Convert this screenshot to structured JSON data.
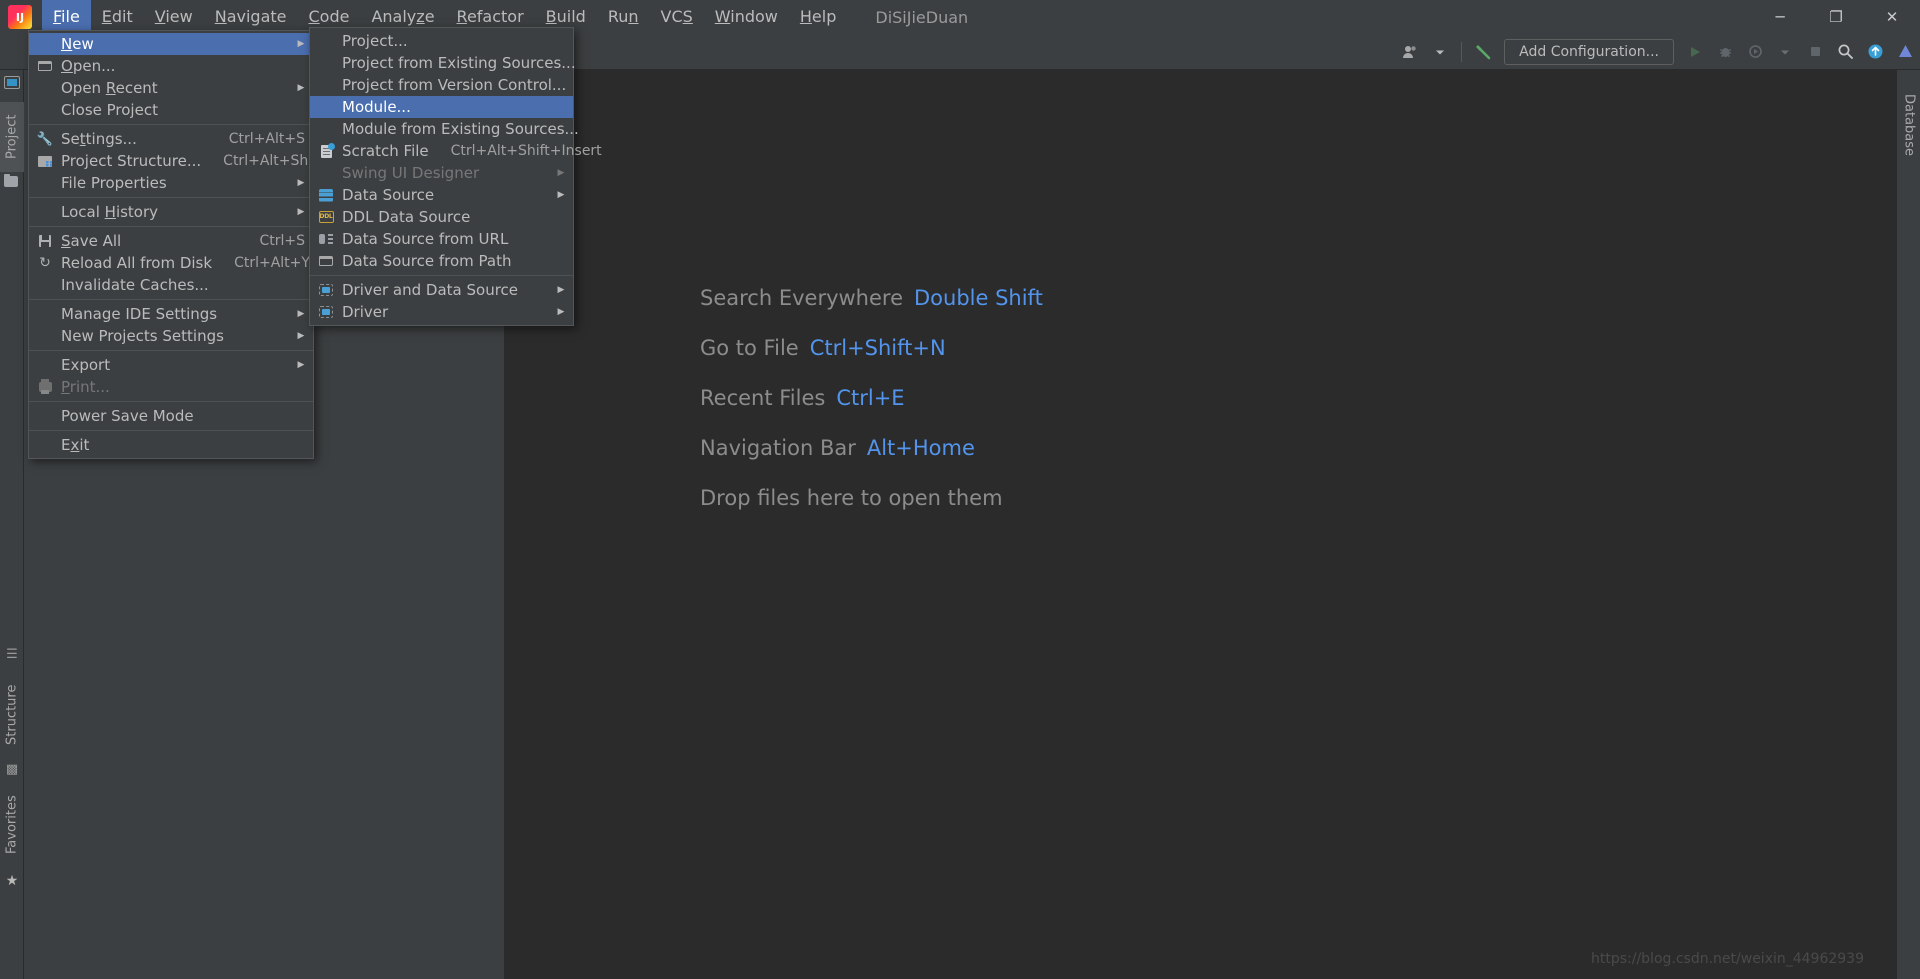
{
  "titlebar": {
    "logo_icon": "intellij-idea-logo",
    "project_name": "DiSiJieDuan",
    "menus": [
      {
        "label": "File",
        "mnemonic": "F",
        "name": "menu-file"
      },
      {
        "label": "Edit",
        "mnemonic": "E",
        "name": "menu-edit"
      },
      {
        "label": "View",
        "mnemonic": "V",
        "name": "menu-view"
      },
      {
        "label": "Navigate",
        "mnemonic": "N",
        "name": "menu-navigate"
      },
      {
        "label": "Code",
        "mnemonic": "C",
        "name": "menu-code"
      },
      {
        "label": "Analyze",
        "mnemonic": "z",
        "name": "menu-analyze"
      },
      {
        "label": "Refactor",
        "mnemonic": "R",
        "name": "menu-refactor"
      },
      {
        "label": "Build",
        "mnemonic": "B",
        "name": "menu-build"
      },
      {
        "label": "Run",
        "mnemonic": "n",
        "name": "menu-run"
      },
      {
        "label": "VCS",
        "mnemonic": "S",
        "name": "menu-vcs"
      },
      {
        "label": "Window",
        "mnemonic": "W",
        "name": "menu-window"
      },
      {
        "label": "Help",
        "mnemonic": "H",
        "name": "menu-help"
      }
    ],
    "window_controls": {
      "minimize": "─",
      "maximize": "❐",
      "close": "✕"
    }
  },
  "toolbar": {
    "user_icon": "user-account-icon",
    "user_dropdown_icon": "chevron-down-icon",
    "build_icon": "hammer-build-icon",
    "add_configuration_label": "Add Configuration...",
    "run_icon": "run-play-icon",
    "debug_icon": "debug-bug-icon",
    "run_coverage_icon": "run-with-coverage-icon",
    "profiler_dropdown_icon": "chevron-down-icon",
    "stop_icon": "stop-icon",
    "search_icon": "search-icon",
    "updates_icon": "update-available-icon",
    "ide_icon": "ide-status-icon"
  },
  "tool_strips": {
    "left": [
      {
        "label": "Project",
        "name": "tool-window-project",
        "selected": true
      },
      {
        "label": "Structure",
        "name": "tool-window-structure",
        "selected": false
      },
      {
        "label": "Favorites",
        "name": "tool-window-favorites",
        "selected": false
      }
    ],
    "right": [
      {
        "label": "Database",
        "name": "tool-window-database",
        "selected": false
      }
    ]
  },
  "file_menu": {
    "name": "file-menu-popup",
    "items": [
      {
        "label": "New",
        "mnemonic": "N",
        "icon": null,
        "shortcut": "",
        "submenu": true,
        "selected": true,
        "separator_after": false,
        "disabled": false,
        "name": "file-menu-new"
      },
      {
        "label": "Open...",
        "mnemonic": "O",
        "icon": "folder-icon",
        "shortcut": "",
        "submenu": false,
        "selected": false,
        "separator_after": false,
        "disabled": false,
        "name": "file-menu-open"
      },
      {
        "label": "Open Recent",
        "mnemonic": "R",
        "icon": null,
        "shortcut": "",
        "submenu": true,
        "selected": false,
        "separator_after": false,
        "disabled": false,
        "name": "file-menu-open-recent"
      },
      {
        "label": "Close Project",
        "mnemonic": "",
        "icon": null,
        "shortcut": "",
        "submenu": false,
        "selected": false,
        "separator_after": true,
        "disabled": false,
        "name": "file-menu-close-project"
      },
      {
        "label": "Settings...",
        "mnemonic": "t",
        "icon": "wrench-icon",
        "shortcut": "Ctrl+Alt+S",
        "submenu": false,
        "selected": false,
        "separator_after": false,
        "disabled": false,
        "name": "file-menu-settings"
      },
      {
        "label": "Project Structure...",
        "mnemonic": "",
        "icon": "project-structure-icon",
        "shortcut": "Ctrl+Alt+Shift+S",
        "submenu": false,
        "selected": false,
        "separator_after": false,
        "disabled": false,
        "name": "file-menu-project-structure"
      },
      {
        "label": "File Properties",
        "mnemonic": "",
        "icon": null,
        "shortcut": "",
        "submenu": true,
        "selected": false,
        "separator_after": true,
        "disabled": false,
        "name": "file-menu-file-properties"
      },
      {
        "label": "Local History",
        "mnemonic": "H",
        "icon": null,
        "shortcut": "",
        "submenu": true,
        "selected": false,
        "separator_after": true,
        "disabled": false,
        "name": "file-menu-local-history"
      },
      {
        "label": "Save All",
        "mnemonic": "S",
        "icon": "save-icon",
        "shortcut": "Ctrl+S",
        "submenu": false,
        "selected": false,
        "separator_after": false,
        "disabled": false,
        "name": "file-menu-save-all"
      },
      {
        "label": "Reload All from Disk",
        "mnemonic": "",
        "icon": "reload-icon",
        "shortcut": "Ctrl+Alt+Y",
        "submenu": false,
        "selected": false,
        "separator_after": false,
        "disabled": false,
        "name": "file-menu-reload-all"
      },
      {
        "label": "Invalidate Caches...",
        "mnemonic": "",
        "icon": null,
        "shortcut": "",
        "submenu": false,
        "selected": false,
        "separator_after": true,
        "disabled": false,
        "name": "file-menu-invalidate-caches"
      },
      {
        "label": "Manage IDE Settings",
        "mnemonic": "",
        "icon": null,
        "shortcut": "",
        "submenu": true,
        "selected": false,
        "separator_after": false,
        "disabled": false,
        "name": "file-menu-manage-ide-settings"
      },
      {
        "label": "New Projects Settings",
        "mnemonic": "",
        "icon": null,
        "shortcut": "",
        "submenu": true,
        "selected": false,
        "separator_after": true,
        "disabled": false,
        "name": "file-menu-new-projects-settings"
      },
      {
        "label": "Export",
        "mnemonic": "",
        "icon": null,
        "shortcut": "",
        "submenu": true,
        "selected": false,
        "separator_after": false,
        "disabled": false,
        "name": "file-menu-export"
      },
      {
        "label": "Print...",
        "mnemonic": "P",
        "icon": "printer-icon",
        "shortcut": "",
        "submenu": false,
        "selected": false,
        "separator_after": true,
        "disabled": true,
        "name": "file-menu-print"
      },
      {
        "label": "Power Save Mode",
        "mnemonic": "",
        "icon": null,
        "shortcut": "",
        "submenu": false,
        "selected": false,
        "separator_after": true,
        "disabled": false,
        "name": "file-menu-power-save-mode"
      },
      {
        "label": "Exit",
        "mnemonic": "x",
        "icon": null,
        "shortcut": "",
        "submenu": false,
        "selected": false,
        "separator_after": false,
        "disabled": false,
        "name": "file-menu-exit"
      }
    ]
  },
  "new_submenu": {
    "name": "new-submenu-popup",
    "items": [
      {
        "label": "Project...",
        "icon": null,
        "shortcut": "",
        "submenu": false,
        "selected": false,
        "separator_after": false,
        "disabled": false,
        "name": "new-project"
      },
      {
        "label": "Project from Existing Sources...",
        "icon": null,
        "shortcut": "",
        "submenu": false,
        "selected": false,
        "separator_after": false,
        "disabled": false,
        "name": "new-project-from-existing-sources"
      },
      {
        "label": "Project from Version Control...",
        "icon": null,
        "shortcut": "",
        "submenu": false,
        "selected": false,
        "separator_after": false,
        "disabled": false,
        "name": "new-project-from-version-control"
      },
      {
        "label": "Module...",
        "icon": null,
        "shortcut": "",
        "submenu": false,
        "selected": true,
        "separator_after": false,
        "disabled": false,
        "name": "new-module"
      },
      {
        "label": "Module from Existing Sources...",
        "icon": null,
        "shortcut": "",
        "submenu": false,
        "selected": false,
        "separator_after": false,
        "disabled": false,
        "name": "new-module-from-existing-sources"
      },
      {
        "label": "Scratch File",
        "icon": "scratch-file-icon",
        "shortcut": "Ctrl+Alt+Shift+Insert",
        "submenu": false,
        "selected": false,
        "separator_after": false,
        "disabled": false,
        "name": "new-scratch-file"
      },
      {
        "label": "Swing UI Designer",
        "icon": null,
        "shortcut": "",
        "submenu": true,
        "selected": false,
        "separator_after": false,
        "disabled": true,
        "name": "new-swing-ui-designer"
      },
      {
        "label": "Data Source",
        "icon": "data-source-icon",
        "shortcut": "",
        "submenu": true,
        "selected": false,
        "separator_after": false,
        "disabled": false,
        "name": "new-data-source"
      },
      {
        "label": "DDL Data Source",
        "icon": "ddl-data-source-icon",
        "shortcut": "",
        "submenu": false,
        "selected": false,
        "separator_after": false,
        "disabled": false,
        "name": "new-ddl-data-source"
      },
      {
        "label": "Data Source from URL",
        "icon": "data-source-url-icon",
        "shortcut": "",
        "submenu": false,
        "selected": false,
        "separator_after": false,
        "disabled": false,
        "name": "new-data-source-from-url"
      },
      {
        "label": "Data Source from Path",
        "icon": "folder-icon",
        "shortcut": "",
        "submenu": false,
        "selected": false,
        "separator_after": true,
        "disabled": false,
        "name": "new-data-source-from-path"
      },
      {
        "label": "Driver and Data Source",
        "icon": "driver-icon",
        "shortcut": "",
        "submenu": true,
        "selected": false,
        "separator_after": false,
        "disabled": false,
        "name": "new-driver-and-data-source"
      },
      {
        "label": "Driver",
        "icon": "driver-icon",
        "shortcut": "",
        "submenu": true,
        "selected": false,
        "separator_after": false,
        "disabled": false,
        "name": "new-driver"
      }
    ]
  },
  "welcome": {
    "tips": [
      {
        "label": "Search Everywhere",
        "key": "Double Shift",
        "name": "tip-search-everywhere"
      },
      {
        "label": "Go to File",
        "key": "Ctrl+Shift+N",
        "name": "tip-go-to-file"
      },
      {
        "label": "Recent Files",
        "key": "Ctrl+E",
        "name": "tip-recent-files"
      },
      {
        "label": "Navigation Bar",
        "key": "Alt+Home",
        "name": "tip-navigation-bar"
      },
      {
        "label": "Drop files here to open them",
        "key": "",
        "name": "tip-drop-files"
      }
    ],
    "watermark": "https://blog.csdn.net/weixin_44962939"
  },
  "colors": {
    "accent_selection": "#4b6eaf",
    "link_blue": "#5394ec",
    "panel_bg": "#3c3f41",
    "editor_bg": "#2b2b2b",
    "text": "#bbbbbb"
  }
}
